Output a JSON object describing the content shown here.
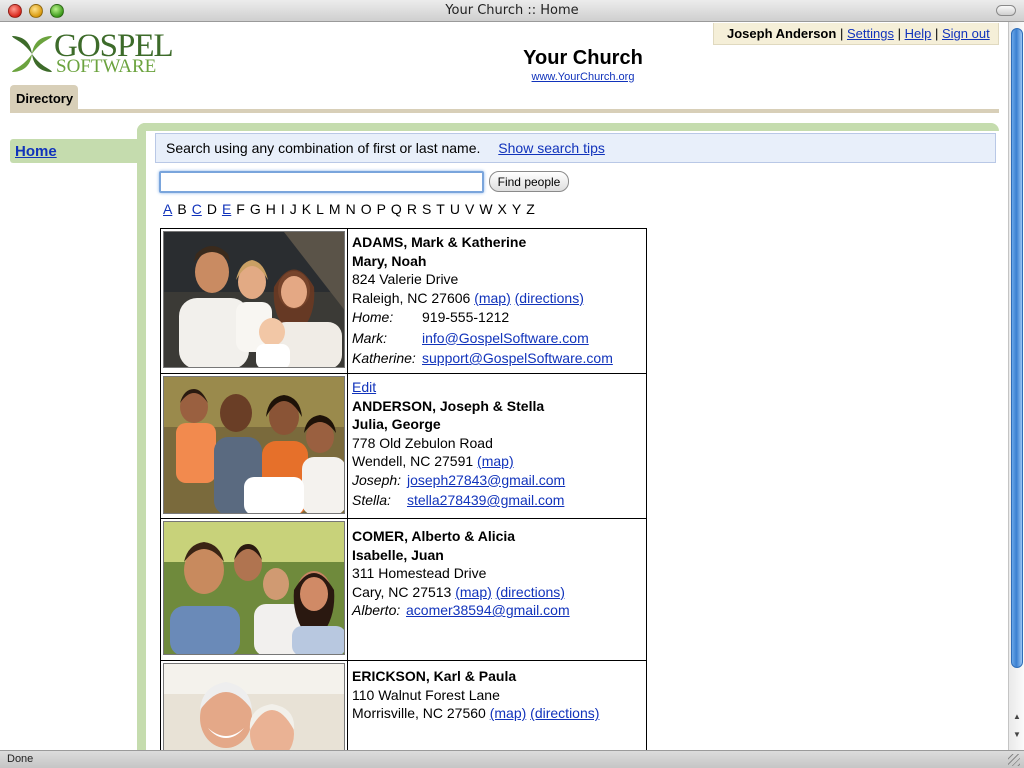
{
  "window": {
    "title": "Your Church :: Home",
    "status": "Done"
  },
  "logo": {
    "line1": "GOSPEL",
    "line2": "SOFTWARE"
  },
  "church": {
    "name": "Your Church",
    "url": "www.YourChurch.org"
  },
  "user": {
    "name": "Joseph Anderson",
    "settings": "Settings",
    "help": "Help",
    "signout": "Sign out",
    "sep": "|"
  },
  "tabs": {
    "directory": "Directory"
  },
  "nav": {
    "home": "Home"
  },
  "search": {
    "tip": "Search using any combination of first or last name.",
    "tips_link": "Show search tips",
    "value": "",
    "button": "Find people"
  },
  "alphabet": [
    {
      "l": "A",
      "link": true
    },
    {
      "l": "B",
      "link": false
    },
    {
      "l": "C",
      "link": true
    },
    {
      "l": "D",
      "link": false
    },
    {
      "l": "E",
      "link": true
    },
    {
      "l": "F",
      "link": false
    },
    {
      "l": "G",
      "link": false
    },
    {
      "l": "H",
      "link": false
    },
    {
      "l": "I",
      "link": false
    },
    {
      "l": "J",
      "link": false
    },
    {
      "l": "K",
      "link": false
    },
    {
      "l": "L",
      "link": false
    },
    {
      "l": "M",
      "link": false
    },
    {
      "l": "N",
      "link": false
    },
    {
      "l": "O",
      "link": false
    },
    {
      "l": "P",
      "link": false
    },
    {
      "l": "Q",
      "link": false
    },
    {
      "l": "R",
      "link": false
    },
    {
      "l": "S",
      "link": false
    },
    {
      "l": "T",
      "link": false
    },
    {
      "l": "U",
      "link": false
    },
    {
      "l": "V",
      "link": false
    },
    {
      "l": "W",
      "link": false
    },
    {
      "l": "X",
      "link": false
    },
    {
      "l": "Y",
      "link": false
    },
    {
      "l": "Z",
      "link": false
    }
  ],
  "entries": [
    {
      "edit": "",
      "family": "ADAMS, Mark & Katherine",
      "children": "Mary, Noah",
      "street": "824 Valerie Drive",
      "city": "Raleigh, NC 27606",
      "map": "(map)",
      "directions": "(directions)",
      "contacts": [
        {
          "label": "Home:",
          "value": "919-555-1212",
          "link": false
        },
        {
          "label": "Mark:",
          "value": "info@GospelSoftware.com",
          "link": true
        },
        {
          "label": "Katherine:",
          "value": "support@GospelSoftware.com",
          "link": true
        }
      ]
    },
    {
      "edit": "Edit",
      "family": "ANDERSON, Joseph & Stella",
      "children": "Julia, George",
      "street": "778 Old Zebulon Road",
      "city": "Wendell, NC 27591",
      "map": "(map)",
      "directions": "",
      "contacts": [
        {
          "label": "Joseph:",
          "value": "joseph27843@gmail.com",
          "link": true
        },
        {
          "label": "Stella:",
          "value": "stella278439@gmail.com",
          "link": true
        }
      ]
    },
    {
      "edit": "",
      "family": "COMER, Alberto & Alicia",
      "children": "Isabelle, Juan",
      "street": "311 Homestead Drive",
      "city": "Cary, NC 27513",
      "map": "(map)",
      "directions": "(directions)",
      "contacts": [
        {
          "label": "Alberto:",
          "value": "acomer38594@gmail.com",
          "link": true
        }
      ]
    },
    {
      "edit": "",
      "family": "ERICKSON, Karl & Paula",
      "children": "",
      "street": "110 Walnut Forest Lane",
      "city": "Morrisville, NC 27560",
      "map": "(map)",
      "directions": "(directions)",
      "contacts": []
    }
  ],
  "colors": {
    "link": "#1133bb",
    "tab": "#d8cfb8",
    "nav": "#c5dcae",
    "tipbg": "#e8effa",
    "userbox": "#f5efd8",
    "logo_dark": "#3d6b2a",
    "logo_light": "#6ba33e"
  }
}
